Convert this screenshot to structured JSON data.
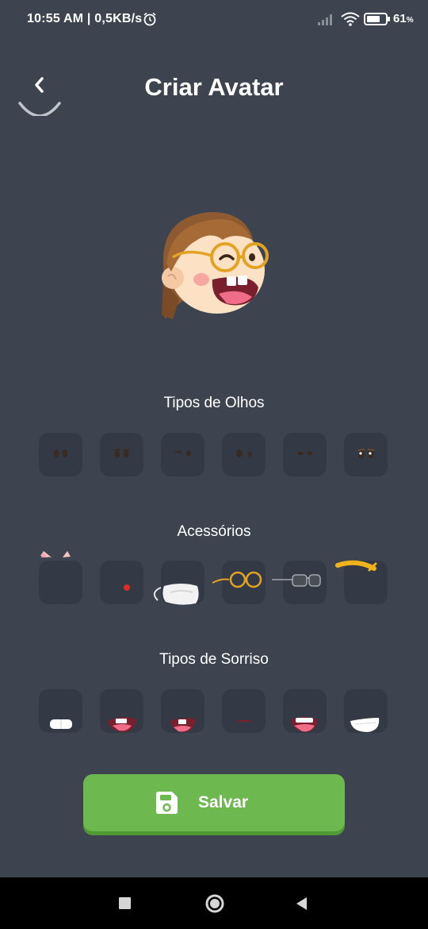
{
  "status_bar": {
    "time": "10:55 AM | 0,5KB/s",
    "battery": "61",
    "battery_unit": "%"
  },
  "header": {
    "title": "Criar Avatar",
    "back_icon": "chevron-left-icon"
  },
  "sections": {
    "eyes": {
      "title": "Tipos de Olhos"
    },
    "accessories": {
      "title": "Acessórios"
    },
    "smiles": {
      "title": "Tipos de Sorriso"
    }
  },
  "save_button": {
    "label": "Salvar",
    "icon": "floppy-disk-icon"
  },
  "colors": {
    "background": "#3d4450",
    "tile": "#343a45",
    "accent_green": "#6db84f"
  }
}
